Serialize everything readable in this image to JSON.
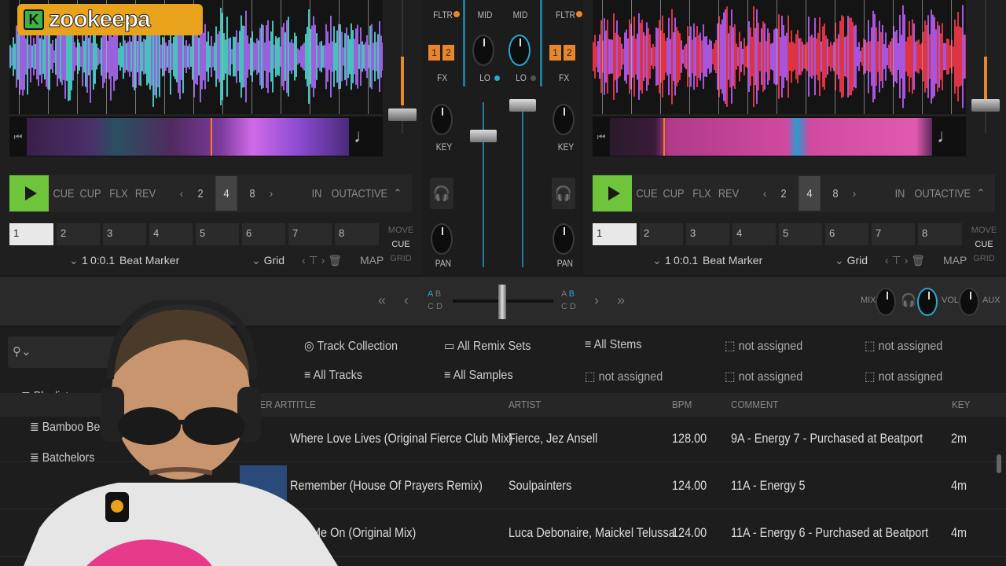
{
  "logo": {
    "badge": "K",
    "text": "zookeepa"
  },
  "decks": [
    {
      "play_label": "",
      "buttons": [
        "CUE",
        "CUP",
        "FLX",
        "REV"
      ],
      "loop_sizes": [
        "2",
        "4",
        "8"
      ],
      "loop_selected": "4",
      "loop_buttons": [
        "IN",
        "OUT",
        "ACTIVE"
      ],
      "cue_slots": [
        "1",
        "2",
        "3",
        "4",
        "5",
        "6",
        "7",
        "8"
      ],
      "cue_active": "1",
      "side_labels": [
        "MOVE",
        "CUE",
        "GRID"
      ],
      "cue_number": "1",
      "cue_position": "0:0.1",
      "cue_type": "Beat Marker",
      "grid_label": "Grid",
      "map_label": "MAP",
      "colors": {
        "waveform_a": "#4fe0d8",
        "waveform_b": "#b070ff"
      }
    },
    {
      "play_label": "",
      "buttons": [
        "CUE",
        "CUP",
        "FLX",
        "REV"
      ],
      "loop_sizes": [
        "2",
        "4",
        "8"
      ],
      "loop_selected": "4",
      "loop_buttons": [
        "IN",
        "OUT",
        "ACTIVE"
      ],
      "cue_slots": [
        "1",
        "2",
        "3",
        "4",
        "5",
        "6",
        "7",
        "8"
      ],
      "cue_active": "1",
      "side_labels": [
        "MOVE",
        "CUE",
        "GRID"
      ],
      "cue_number": "1",
      "cue_position": "0:0.1",
      "cue_type": "Beat Marker",
      "grid_label": "Grid",
      "map_label": "MAP",
      "colors": {
        "waveform_a": "#ff3a4a",
        "waveform_b": "#c060ff"
      }
    }
  ],
  "mixer": {
    "left": {
      "fltr": "FLTR",
      "fx_nums": [
        "1",
        "2"
      ],
      "fx": "FX",
      "key": "KEY",
      "pan": "PAN"
    },
    "right": {
      "fltr": "FLTR",
      "fx_nums": [
        "1",
        "2"
      ],
      "fx": "FX",
      "key": "KEY",
      "pan": "PAN"
    },
    "eq": {
      "mid": "MID",
      "lo": "LO"
    }
  },
  "crossfader": {
    "left_letters": [
      "A",
      "B",
      "C",
      "D"
    ],
    "right_letters": [
      "A",
      "B",
      "C",
      "D"
    ],
    "left_arrows": [
      "«",
      "‹"
    ],
    "right_arrows": [
      "›",
      "»"
    ],
    "master": {
      "mix": "MIX",
      "vol": "VOL",
      "aux": "AUX"
    }
  },
  "browser": {
    "favorites": [
      {
        "label": "Track Collection",
        "icon": "collection-icon"
      },
      {
        "label": "All Remix Sets",
        "icon": "folder-icon"
      },
      {
        "label": "All Stems",
        "icon": "list-icon"
      },
      {
        "label": "not assigned",
        "icon": "empty-icon"
      },
      {
        "label": "not assigned",
        "icon": "empty-icon"
      },
      {
        "label": "All Tracks",
        "icon": "list-icon"
      },
      {
        "label": "All Samples",
        "icon": "list-icon"
      },
      {
        "label": "not assigned",
        "icon": "empty-icon"
      },
      {
        "label": "not assigned",
        "icon": "empty-icon"
      },
      {
        "label": "not assigned",
        "icon": "empty-icon"
      }
    ],
    "tree": {
      "root": "Playlists",
      "items": [
        "Bamboo Beach",
        "Batchelors"
      ]
    },
    "columns": {
      "cover": "COVER ART",
      "title": "TITLE",
      "artist": "ARTIST",
      "bpm": "BPM",
      "comment": "COMMENT",
      "key": "KEY"
    },
    "rows": [
      {
        "title": "Where Love Lives (Original Fierce Club Mix)",
        "artist": "Fierce, Jez Ansell",
        "bpm": "128.00",
        "comment": "9A - Energy 7 - Purchased at Beatport",
        "key": "2m"
      },
      {
        "title": "Remember (House Of Prayers Remix)",
        "artist": "Soulpainters",
        "bpm": "124.00",
        "comment": "11A - Energy 5",
        "key": "4m"
      },
      {
        "title": "Me On (Original Mix)",
        "artist": "Luca Debonaire, Maickel Telussa",
        "bpm": "124.00",
        "comment": "11A - Energy 6 - Purchased at Beatport",
        "key": "4m"
      }
    ]
  }
}
